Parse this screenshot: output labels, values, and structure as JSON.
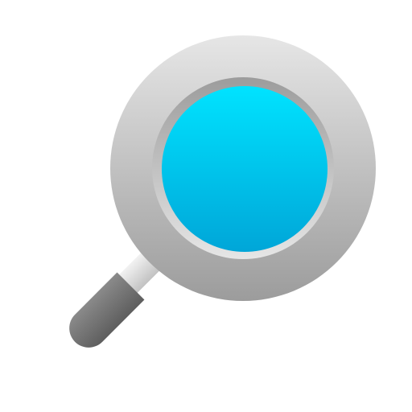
{
  "icon": {
    "name": "magnifying-glass-icon",
    "colors": {
      "background": "#ffffff",
      "lens_top": "#00e3ff",
      "lens_bottom": "#00a6d8",
      "rim_light": "#e6e6e6",
      "rim_dark": "#9c9c9c",
      "inner_ring": "#a3a3a3",
      "neck_light": "#f2f2f2",
      "neck_dark": "#c2c2c2",
      "handle_light": "#8a8a8a",
      "handle_dark": "#5e5e5e"
    }
  }
}
